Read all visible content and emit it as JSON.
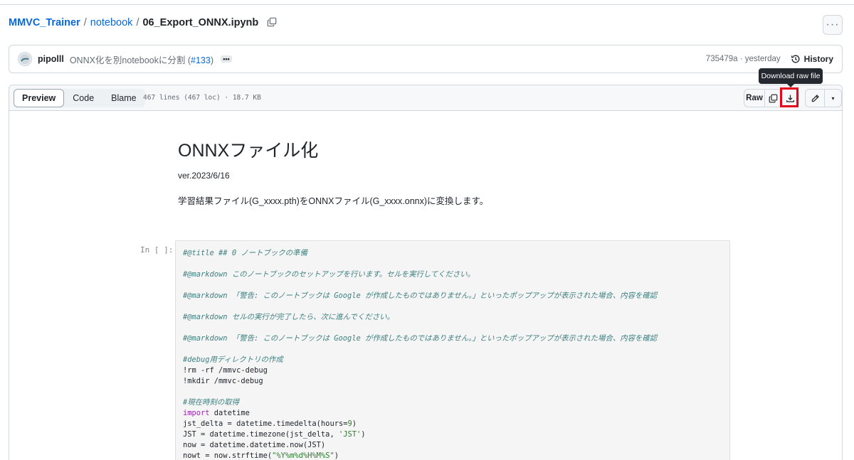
{
  "breadcrumb": {
    "repo": "MMVC_Trainer",
    "sep1": "/",
    "folder": "notebook",
    "sep2": "/",
    "file": "06_Export_ONNX.ipynb"
  },
  "more_label": "···",
  "commit": {
    "author": "pipolll",
    "message": "ONNX化を別notebookに分割 (",
    "pr_link": "#133",
    "message_end": ")",
    "ellipsis": "•••",
    "sha_time": "735479a · yesterday",
    "history_label": "History"
  },
  "tooltip": "Download raw file",
  "file_header": {
    "tabs": [
      "Preview",
      "Code",
      "Blame"
    ],
    "info": "467 lines (467 loc) · 18.7 KB",
    "raw_label": "Raw",
    "caret": "▾"
  },
  "notebook": {
    "title": "ONNXファイル化",
    "version": "ver.2023/6/16",
    "description": "学習結果ファイル(G_xxxx.pth)をONNXファイル(G_xxxx.onnx)に変換します。",
    "in_label": "In [ ]:",
    "code": {
      "l1": "#@title ## 0 ノートブックの準備",
      "l2": "#@markdown このノートブックのセットアップを行います。セルを実行してください。",
      "l3": "#@markdown 「警告: このノートブックは Google が作成したものではありません。」といったポップアップが表示された場合、内容を確認",
      "l4": "#@markdown セルの実行が完了したら、次に進んでください。",
      "l5": "#@markdown 「警告: このノートブックは Google が作成したものではありません。」といったポップアップが表示された場合、内容を確認",
      "l6": "#debug用ディレクトリの作成",
      "l7": "!rm -rf /mmvc-debug",
      "l8": "!mkdir /mmvc-debug",
      "l9": "#現在時刻の取得",
      "l10_kw": "import",
      "l10_rest": " datetime",
      "l11_a": "jst_delta = datetime.timedelta(hours=",
      "l11_num": "9",
      "l11_b": ")",
      "l12_a": "JST = datetime.timezone(jst_delta, ",
      "l12_str": "'JST'",
      "l12_b": ")",
      "l13": "now = datetime.datetime.now(JST)",
      "l14_a": "nowt = now.strftime(",
      "l14_str": "\"%Y%m%d%H%M%S\"",
      "l14_b": ")"
    }
  }
}
